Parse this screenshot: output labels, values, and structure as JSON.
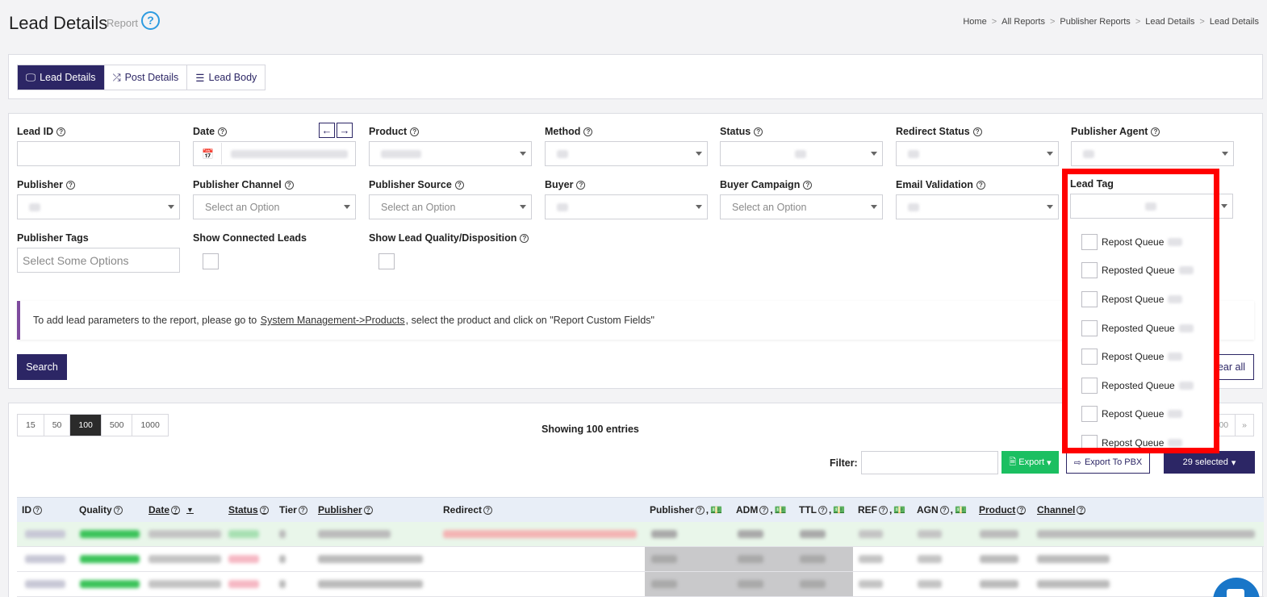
{
  "header": {
    "title": "Lead Details",
    "subtitle": "Report",
    "help_glyph": "?",
    "breadcrumb": [
      "Home",
      "All Reports",
      "Publisher Reports",
      "Lead Details",
      "Lead Details"
    ],
    "breadcrumb_sep": ">"
  },
  "tabs": [
    {
      "label": "Lead Details",
      "icon": "monitor-icon",
      "active": true
    },
    {
      "label": "Post Details",
      "icon": "shuffle-icon",
      "active": false
    },
    {
      "label": "Lead Body",
      "icon": "list-icon",
      "active": false
    }
  ],
  "filters": {
    "lead_id": {
      "label": "Lead ID"
    },
    "date": {
      "label": "Date"
    },
    "product": {
      "label": "Product"
    },
    "method": {
      "label": "Method"
    },
    "status": {
      "label": "Status"
    },
    "redirect_status": {
      "label": "Redirect Status"
    },
    "publisher_agent": {
      "label": "Publisher Agent"
    },
    "publisher": {
      "label": "Publisher"
    },
    "publisher_channel": {
      "label": "Publisher Channel",
      "placeholder": "Select an Option"
    },
    "publisher_source": {
      "label": "Publisher Source",
      "placeholder": "Select an Option"
    },
    "buyer": {
      "label": "Buyer"
    },
    "buyer_campaign": {
      "label": "Buyer Campaign",
      "placeholder": "Select an Option"
    },
    "email_validation": {
      "label": "Email Validation"
    },
    "lead_tag": {
      "label": "Lead Tag"
    },
    "publisher_tags": {
      "label": "Publisher Tags",
      "placeholder": "Select Some Options"
    },
    "show_connected": {
      "label": "Show Connected Leads"
    },
    "show_quality": {
      "label": "Show Lead Quality/Disposition"
    }
  },
  "info": {
    "before": "To add lead parameters to the report, please go to",
    "link": "System Management->Products",
    "after": ", select the product and click on \"Report Custom Fields\""
  },
  "buttons": {
    "search": "Search",
    "clear_all": "ear all",
    "export": "Export",
    "export_pbx": "Export To PBX",
    "selected": "29 selected"
  },
  "page_sizes": [
    "15",
    "50",
    "100",
    "500",
    "1000"
  ],
  "active_page_size": "100",
  "showing": "Showing 100 entries",
  "pagination": [
    "00",
    "»"
  ],
  "filter_label": "Filter:",
  "columns": [
    {
      "label": "ID",
      "underline": false
    },
    {
      "label": "Quality",
      "underline": false
    },
    {
      "label": "Date",
      "underline": true
    },
    {
      "label": "Status",
      "underline": true
    },
    {
      "label": "Tier",
      "underline": false
    },
    {
      "label": "Publisher",
      "underline": true
    },
    {
      "label": "Redirect",
      "underline": false
    },
    {
      "label": "Publisher",
      "underline": false
    },
    {
      "label": "ADM",
      "underline": false
    },
    {
      "label": "TTL",
      "underline": false
    },
    {
      "label": "REF",
      "underline": false
    },
    {
      "label": "AGN",
      "underline": false
    },
    {
      "label": "Product",
      "underline": true
    },
    {
      "label": "Channel",
      "underline": true
    }
  ],
  "lead_tag_options": [
    "Repost Queue",
    "Reposted Queue",
    "Repost Queue",
    "Reposted Queue",
    "Repost Queue",
    "Reposted Queue",
    "Repost Queue",
    "Repost Queue"
  ],
  "colors": {
    "primary": "#2c2665",
    "export_green": "#1bbf61",
    "highlight": "#ff0000",
    "info_accent": "#7e4b9e",
    "help_blue": "#2d9be0"
  }
}
